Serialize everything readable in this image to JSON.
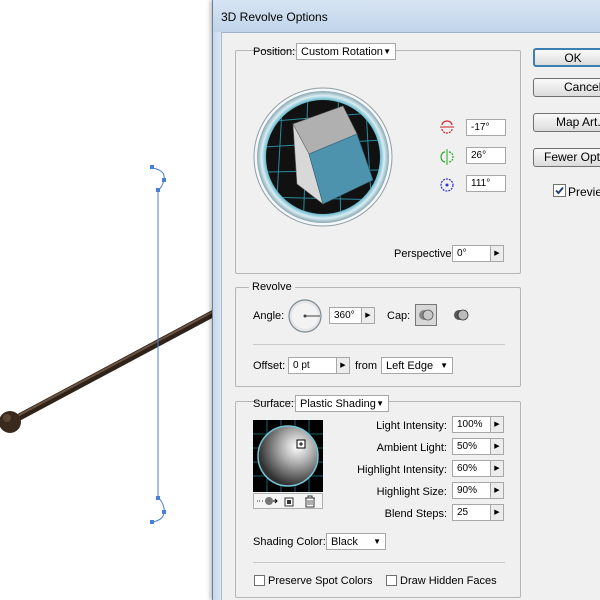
{
  "dialog": {
    "title": "3D Revolve Options"
  },
  "position": {
    "label": "Position:",
    "preset": "Custom Rotation",
    "x_rotation": "-17°",
    "y_rotation": "26°",
    "z_rotation": "111°",
    "perspective_label": "Perspective:",
    "perspective_value": "0°"
  },
  "revolve": {
    "section_label": "Revolve",
    "angle_label": "Angle:",
    "angle_value": "360°",
    "cap_label": "Cap:",
    "offset_label": "Offset:",
    "offset_value": "0 pt",
    "from_label": "from",
    "from_value": "Left Edge"
  },
  "surface": {
    "label": "Surface:",
    "value": "Plastic Shading",
    "light_intensity_label": "Light Intensity:",
    "light_intensity_value": "100%",
    "ambient_light_label": "Ambient Light:",
    "ambient_light_value": "50%",
    "highlight_intensity_label": "Highlight Intensity:",
    "highlight_intensity_value": "60%",
    "highlight_size_label": "Highlight Size:",
    "highlight_size_value": "90%",
    "blend_steps_label": "Blend Steps:",
    "blend_steps_value": "25",
    "shading_color_label": "Shading Color:",
    "shading_color_value": "Black",
    "preserve_spot_colors_label": "Preserve Spot Colors",
    "draw_hidden_faces_label": "Draw Hidden Faces"
  },
  "buttons": {
    "ok": "OK",
    "cancel": "Cancel",
    "map_art": "Map Art...",
    "fewer_options": "Fewer Options",
    "preview_label": "Preview"
  },
  "colors": {
    "cube_front": "#4d93ad",
    "cube_top": "#b0b0b0",
    "cube_side": "#d8d8d8",
    "sphere_ring": "#76c6d8",
    "stroke_rod": "#3a2a1e",
    "path_blue": "#4a7fd8"
  }
}
